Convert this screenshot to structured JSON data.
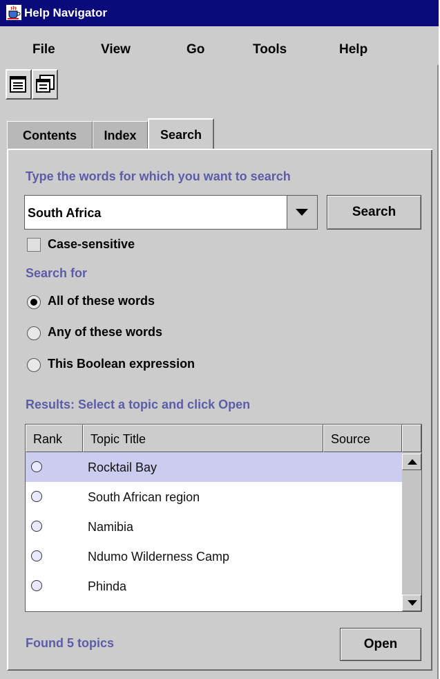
{
  "window": {
    "title": "Help Navigator",
    "icon": "java-cup-icon"
  },
  "menubar": {
    "items": [
      "File",
      "View",
      "Go",
      "Tools",
      "Help"
    ]
  },
  "toolbar": {
    "buttons": [
      "toc-sync-icon",
      "print-icon"
    ]
  },
  "tabs": {
    "items": [
      "Contents",
      "Index",
      "Search"
    ],
    "active": "Search"
  },
  "search": {
    "prompt": "Type the words for which you want to search",
    "query": "South Africa",
    "search_button": "Search",
    "case_sensitive_label": "Case-sensitive",
    "case_sensitive": false,
    "search_for_label": "Search for",
    "options": [
      "All of these words",
      "Any of these words",
      "This Boolean expression"
    ],
    "selected_option": "All of these words"
  },
  "results": {
    "label": "Results: Select a topic and click Open",
    "columns": [
      "Rank",
      "Topic Title",
      "Source"
    ],
    "rows": [
      {
        "title": "Rocktail Bay",
        "selected": true
      },
      {
        "title": "South African region",
        "selected": false
      },
      {
        "title": "Namibia",
        "selected": false
      },
      {
        "title": "Ndumo Wilderness Camp",
        "selected": false
      },
      {
        "title": "Phinda",
        "selected": false
      }
    ],
    "status": "Found 5 topics",
    "open_button": "Open"
  },
  "colors": {
    "titlebar": "#0a0a7a",
    "panel": "#cccccc",
    "label_accent": "#5c5ca8",
    "selection": "#ccccf0"
  }
}
